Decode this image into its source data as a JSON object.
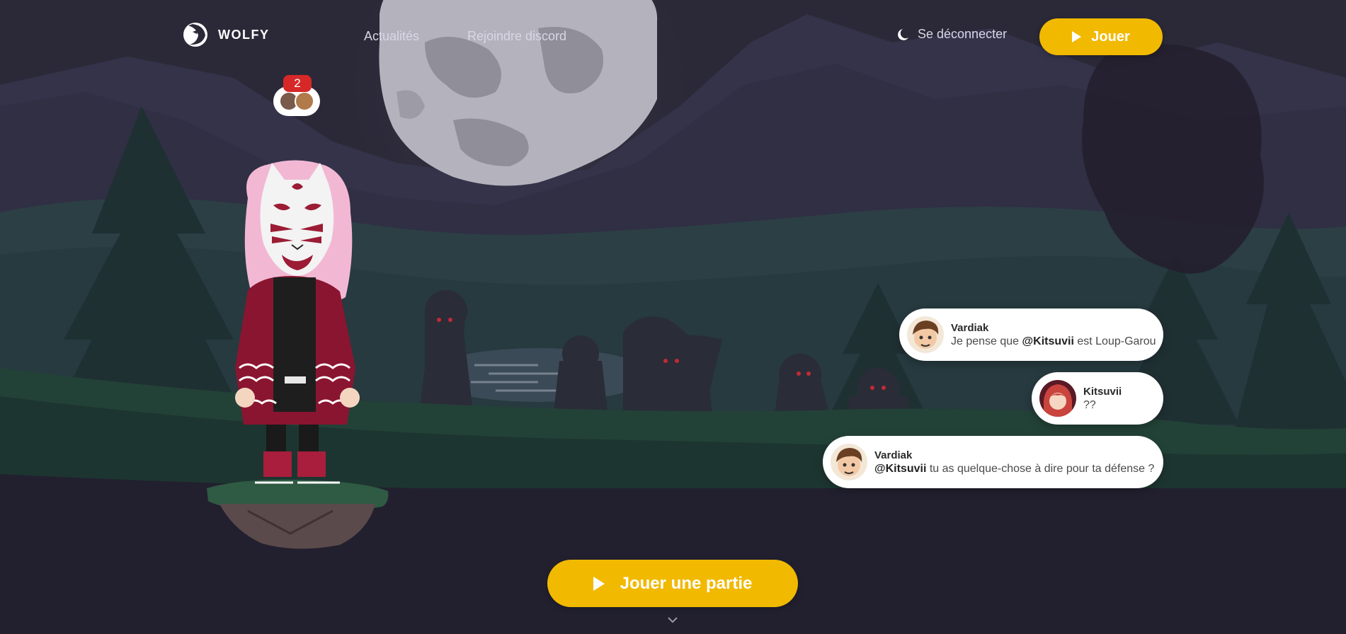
{
  "header": {
    "brand": "WOLFY",
    "nav": [
      {
        "label": "Actualités"
      },
      {
        "label": "Rejoindre discord"
      }
    ],
    "logout_label": "Se déconnecter",
    "play_label": "Jouer"
  },
  "friends": {
    "count": "2"
  },
  "chat": [
    {
      "author": "Vardiak",
      "before": "Je pense que ",
      "mention": "@Kitsuvii",
      "after": " est Loup-Garou"
    },
    {
      "author": "Kitsuvii",
      "before": "??",
      "mention": "",
      "after": ""
    },
    {
      "author": "Vardiak",
      "before": "",
      "mention": "@Kitsuvii",
      "after": " tu as quelque-chose à dire pour ta défense ?"
    }
  ],
  "cta": {
    "label": "Jouer une partie"
  },
  "colors": {
    "accent": "#f1b900",
    "badge": "#d72828",
    "background": "#22202f"
  },
  "icons": [
    "wolf-logo-icon",
    "moon-icon",
    "play-icon",
    "chevron-down-icon"
  ]
}
